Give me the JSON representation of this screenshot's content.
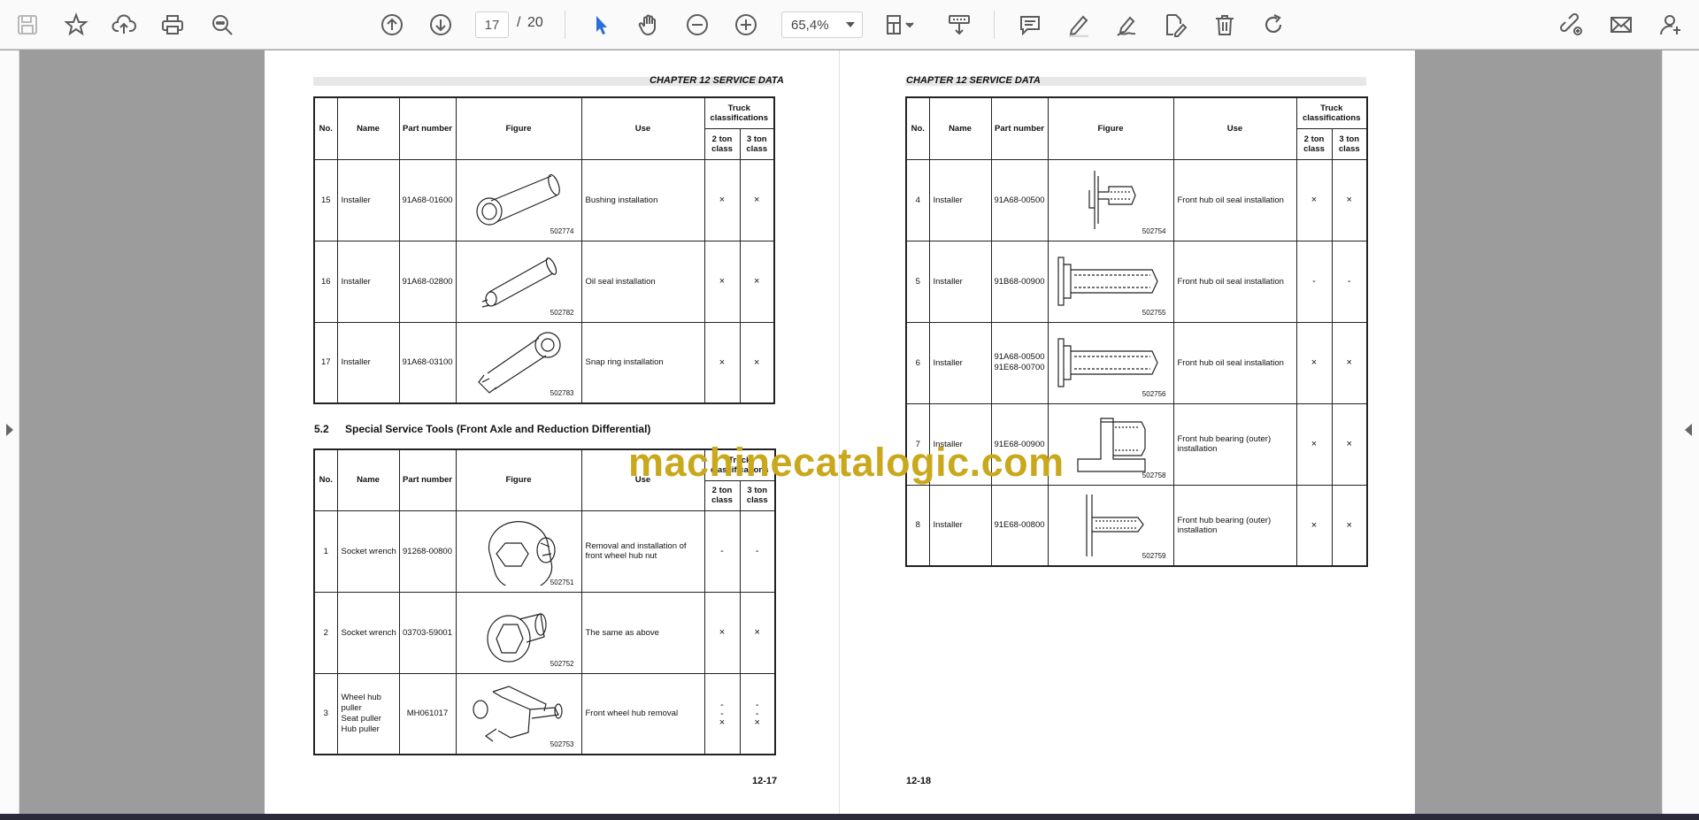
{
  "toolbar": {
    "current_page": "17",
    "page_separator": "/",
    "total_pages": "20",
    "zoom": "65,4%",
    "icons": [
      "save-icon",
      "bookmark-star-icon",
      "upload-cloud-icon",
      "print-icon",
      "zoom-search-icon",
      "page-up-icon",
      "page-down-icon",
      "select-arrow-icon",
      "hand-pan-icon",
      "zoom-out-icon",
      "zoom-in-icon",
      "fit-page-icon",
      "scroll-mode-icon",
      "comment-icon",
      "highlight-pen-icon",
      "sign-pen-icon",
      "edit-file-icon",
      "delete-icon",
      "rotate-icon",
      "share-link-icon",
      "email-icon",
      "add-user-icon"
    ],
    "accent": "#2b6fd6"
  },
  "left_page": {
    "chapter": "CHAPTER 12 SERVICE DATA",
    "page_number": "12-17",
    "table_headers": {
      "no": "No.",
      "name": "Name",
      "part": "Part number",
      "figure": "Figure",
      "use": "Use",
      "truck": "Truck classifications",
      "class2": "2 ton class",
      "class3": "3 ton class"
    },
    "table1_rows": [
      {
        "no": "15",
        "name": "Installer",
        "part": "91A68-01600",
        "fig": "502774",
        "use": "Bushing installation",
        "c2": "×",
        "c3": "×"
      },
      {
        "no": "16",
        "name": "Installer",
        "part": "91A68-02800",
        "fig": "502782",
        "use": "Oil seal installation",
        "c2": "×",
        "c3": "×"
      },
      {
        "no": "17",
        "name": "Installer",
        "part": "91A68-03100",
        "fig": "502783",
        "use": "Snap ring installation",
        "c2": "×",
        "c3": "×"
      }
    ],
    "section_number": "5.2",
    "section_title": "Special Service Tools (Front Axle and Reduction Differential)",
    "table2_rows": [
      {
        "no": "1",
        "name": "Socket wrench",
        "part": "91268-00800",
        "fig": "502751",
        "use": "Removal and installation of front wheel hub nut",
        "c2": "-",
        "c3": "-"
      },
      {
        "no": "2",
        "name": "Socket wrench",
        "part": "03703-59001",
        "fig": "502752",
        "use": "The same as above",
        "c2": "×",
        "c3": "×"
      },
      {
        "no": "3",
        "name": "Wheel hub puller\nSeat puller\nHub puller",
        "part": "MH061017",
        "fig": "502753",
        "use": "Front wheel hub removal",
        "c2": "-\n-\n×",
        "c3": "-\n-\n×"
      }
    ]
  },
  "right_page": {
    "chapter": "CHAPTER 12 SERVICE DATA",
    "page_number": "12-18",
    "table_rows": [
      {
        "no": "4",
        "name": "Installer",
        "part": "91A68-00500",
        "fig": "502754",
        "use": "Front hub oil seal installation",
        "c2": "×",
        "c3": "×"
      },
      {
        "no": "5",
        "name": "Installer",
        "part": "91B68-00900",
        "fig": "502755",
        "use": "Front hub oil seal installation",
        "c2": "-",
        "c3": "-"
      },
      {
        "no": "6",
        "name": "Installer",
        "part": "91A68-00500\n91E68-00700",
        "fig": "502756",
        "use": "Front hub oil seal installation",
        "c2": "×",
        "c3": "×"
      },
      {
        "no": "7",
        "name": "Installer",
        "part": "91E68-00900",
        "fig": "502758",
        "use": "Front hub bearing (outer) installation",
        "c2": "×",
        "c3": "×"
      },
      {
        "no": "8",
        "name": "Installer",
        "part": "91E68-00800",
        "fig": "502759",
        "use": "Front hub bearing (outer) installation",
        "c2": "×",
        "c3": "×"
      }
    ]
  },
  "watermark": "machinecatalogic.com"
}
